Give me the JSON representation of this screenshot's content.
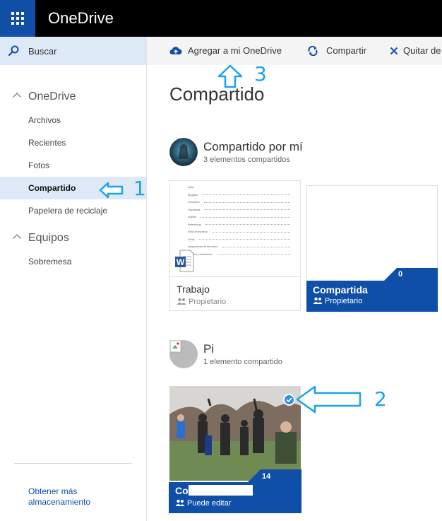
{
  "header": {
    "app_title": "OneDrive"
  },
  "leftnav": {
    "search_label": "Buscar",
    "section_onedrive": "OneDrive",
    "items": [
      {
        "label": "Archivos"
      },
      {
        "label": "Recientes"
      },
      {
        "label": "Fotos"
      },
      {
        "label": "Compartido",
        "active": true
      },
      {
        "label": "Papelera de reciclaje"
      }
    ],
    "section_equipos": "Equipos",
    "equipos_items": [
      {
        "label": "Sobremesa"
      }
    ],
    "storage_link": "Obtener más almacenamiento"
  },
  "commandbar": {
    "add_label": "Agregar a mi OneDrive",
    "share_label": "Compartir",
    "remove_label": "Quitar de"
  },
  "main": {
    "title": "Compartido",
    "by_me": {
      "title": "Compartido por mí",
      "subtitle": "3 elementos compartidos",
      "doc_tile": {
        "name": "Trabajo",
        "meta": "Propietario",
        "doc_lines": [
          "Indice",
          "Biografía",
          "Formación",
          "Trayectoria",
          "Análisis",
          "Referencias",
          "Estilo de escritura",
          "Obras",
          "Adaptaciones de sus obras",
          "Premios y distinciones"
        ]
      },
      "folder_tile": {
        "name": "Compartida",
        "meta": "Propietario",
        "count": "0"
      }
    },
    "by_other": {
      "title": "Pi",
      "subtitle": "1 elemento compartido",
      "folder_tile": {
        "name": "Co",
        "meta": "Puede editar",
        "count": "14"
      }
    }
  },
  "annotations": {
    "one": "1",
    "two": "2",
    "three": "3"
  },
  "colors": {
    "accent": "#0f4fa8",
    "header": "#000000",
    "highlight": "#dde9f6",
    "annotation": "#1aa3e8"
  }
}
